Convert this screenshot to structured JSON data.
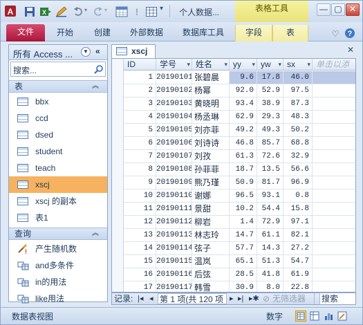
{
  "titlebar": {
    "document_title": "个人数据...",
    "context_tab_group": "表格工具",
    "window_buttons": [
      "minimize-icon",
      "restore-icon",
      "close-icon"
    ]
  },
  "ribbon": {
    "tabs": [
      {
        "label": "文件",
        "kind": "file"
      },
      {
        "label": "开始",
        "kind": "normal"
      },
      {
        "label": "创建",
        "kind": "normal"
      },
      {
        "label": "外部数据",
        "kind": "normal"
      },
      {
        "label": "数据库工具",
        "kind": "normal"
      },
      {
        "label": "字段",
        "kind": "ctx"
      },
      {
        "label": "表",
        "kind": "ctx"
      }
    ]
  },
  "nav": {
    "header": "所有 Access ...",
    "search_placeholder": "搜索...",
    "groups": [
      {
        "title": "表",
        "items": [
          {
            "label": "bbx",
            "selected": false
          },
          {
            "label": "ccd",
            "selected": false
          },
          {
            "label": "dsed",
            "selected": false
          },
          {
            "label": "student",
            "selected": false
          },
          {
            "label": "teach",
            "selected": false
          },
          {
            "label": "xscj",
            "selected": true
          },
          {
            "label": "xscj 的副本",
            "selected": false
          },
          {
            "label": "表1",
            "selected": false
          }
        ]
      },
      {
        "title": "查询",
        "items": [
          {
            "label": "产生随机数"
          },
          {
            "label": "and多条件"
          },
          {
            "label": "in的用法"
          },
          {
            "label": "like用法"
          }
        ]
      }
    ]
  },
  "document": {
    "tab_title": "xscj"
  },
  "grid": {
    "columns": [
      "ID",
      "学号",
      "姓名",
      "yy",
      "yw",
      "sx",
      "单击以添"
    ],
    "rows": [
      [
        "1",
        "20190101",
        "张碧晨",
        "9.6",
        "17.8",
        "46.0"
      ],
      [
        "2",
        "20190102",
        "杨幂",
        "92.0",
        "52.9",
        "97.5"
      ],
      [
        "3",
        "20190103",
        "黄晓明",
        "93.4",
        "38.9",
        "87.3"
      ],
      [
        "4",
        "20190104",
        "杨丞琳",
        "62.9",
        "29.3",
        "48.3"
      ],
      [
        "5",
        "20190105",
        "刘亦菲",
        "49.2",
        "49.3",
        "50.2"
      ],
      [
        "6",
        "20190106",
        "刘诗诗",
        "46.8",
        "85.7",
        "68.8"
      ],
      [
        "7",
        "20190107",
        "刘孜",
        "61.3",
        "72.6",
        "32.9"
      ],
      [
        "8",
        "20190108",
        "孙菲菲",
        "18.7",
        "13.5",
        "56.6"
      ],
      [
        "9",
        "20190109",
        "熊乃瑾",
        "50.9",
        "81.7",
        "96.9"
      ],
      [
        "10",
        "20190110",
        "谢娜",
        "96.5",
        "93.1",
        "0.8"
      ],
      [
        "11",
        "20190111",
        "景甜",
        "10.2",
        "54.4",
        "15.8"
      ],
      [
        "12",
        "20190112",
        "柳岩",
        "1.4",
        "72.9",
        "97.1"
      ],
      [
        "13",
        "20190113",
        "林志玲",
        "14.7",
        "61.1",
        "82.1"
      ],
      [
        "14",
        "20190114",
        "弦子",
        "57.7",
        "14.3",
        "27.2"
      ],
      [
        "15",
        "20190115",
        "温岚",
        "65.1",
        "51.3",
        "54.7"
      ],
      [
        "16",
        "20190116",
        "后弦",
        "28.5",
        "41.8",
        "61.9"
      ],
      [
        "17",
        "20190117",
        "韩雪",
        "30.9",
        "8.0",
        "22.8"
      ]
    ]
  },
  "recordnav": {
    "label": "记录:",
    "position": "第 1 项(共 120 项",
    "filter": "无筛选器",
    "search": "搜索"
  },
  "status": {
    "view": "数据表视图",
    "mode": "数字"
  }
}
